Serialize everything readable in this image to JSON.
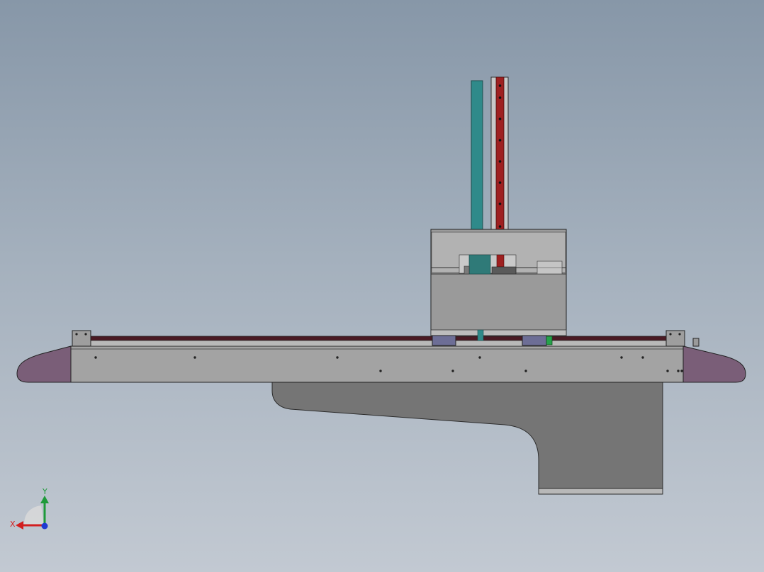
{
  "viewport": {
    "background_top": "#8797a8",
    "background_bottom": "#c2c9d2"
  },
  "colors": {
    "frame_fill": "#a3a3a3",
    "base_fill": "#757575",
    "end_cap_fill": "#7a5e78",
    "carriage_fill": "#9a9a9a",
    "teal_rod": "#2f8a8a",
    "red_rail": "#9e2020",
    "rail_dark": "#4a1a24",
    "slider_block": "#6d6e96",
    "green_part": "#25a24a"
  },
  "triad": {
    "x_label": "X",
    "y_label": "Y",
    "x_color": "#d21f1f",
    "y_color": "#1f9a3a",
    "z_color": "#1f3ad2"
  }
}
